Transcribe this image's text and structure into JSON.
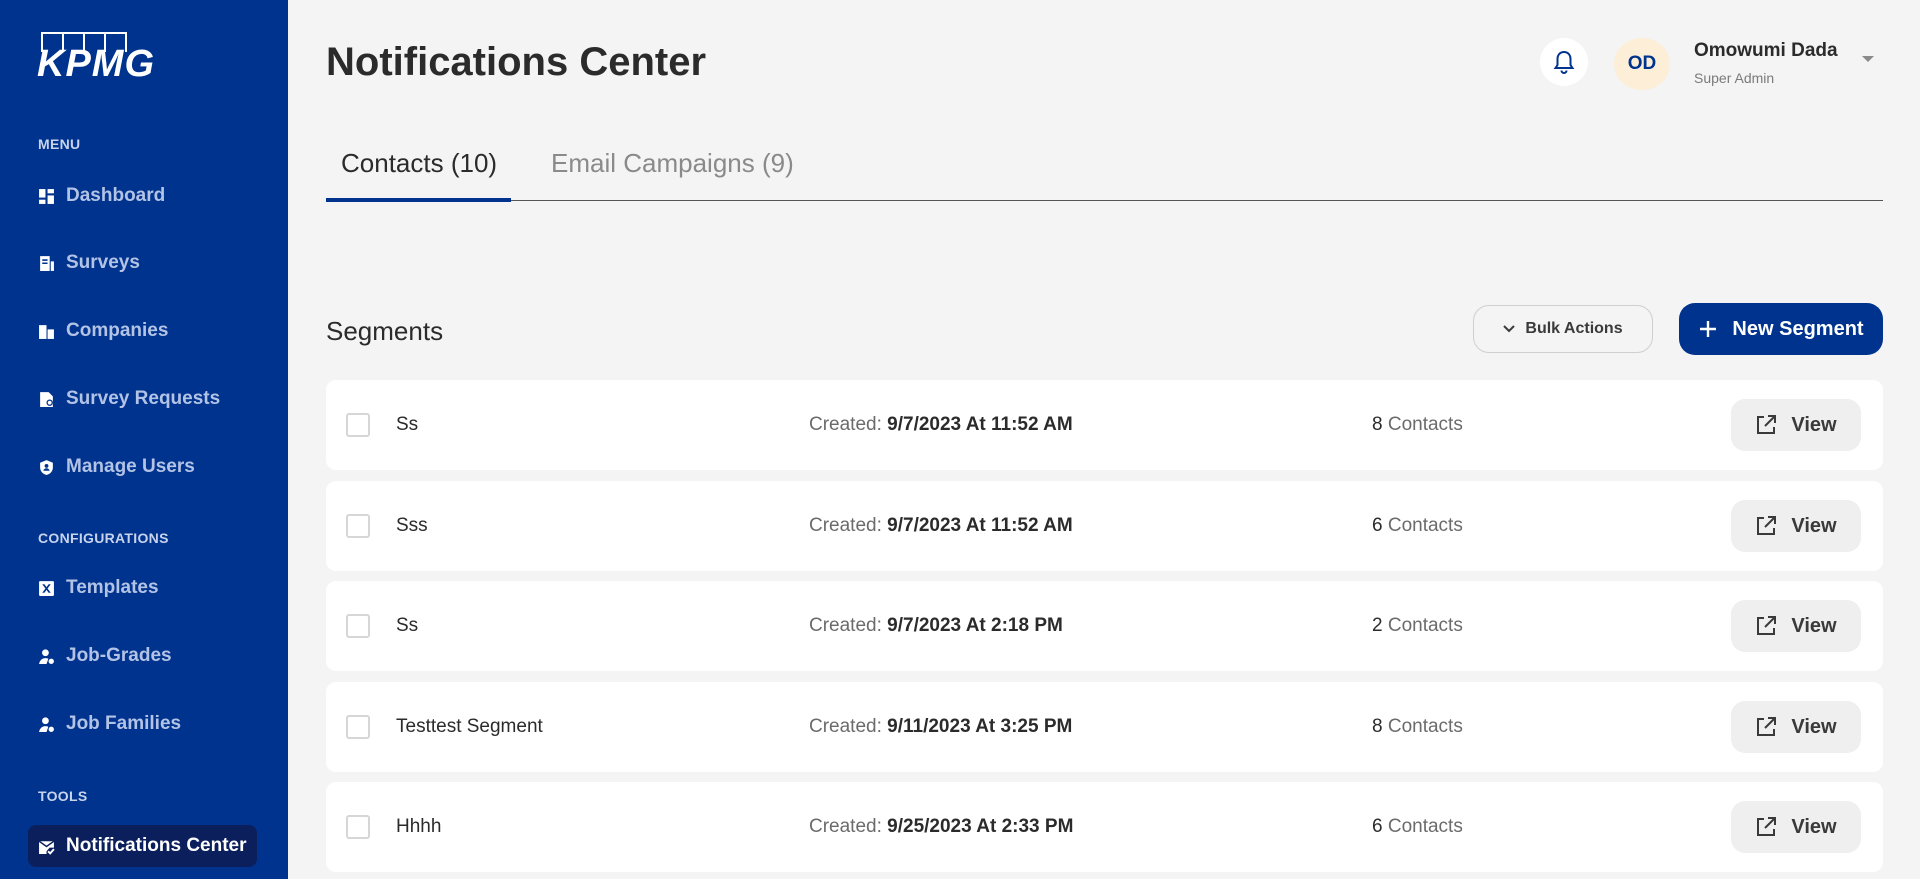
{
  "sidebar": {
    "logo": "KPMG",
    "menu_label": "MENU",
    "menu_items": [
      {
        "label": "Dashboard",
        "icon": "dashboard-icon"
      },
      {
        "label": "Surveys",
        "icon": "survey-icon"
      },
      {
        "label": "Companies",
        "icon": "building-icon"
      },
      {
        "label": "Survey Requests",
        "icon": "request-icon"
      },
      {
        "label": "Manage Users",
        "icon": "shield-user-icon"
      }
    ],
    "config_label": "CONFIGURATIONS",
    "config_items": [
      {
        "label": "Templates",
        "icon": "excel-icon"
      },
      {
        "label": "Job-Grades",
        "icon": "user-gear-icon"
      },
      {
        "label": "Job Families",
        "icon": "user-gear-icon"
      }
    ],
    "tools_label": "TOOLS",
    "tools_items": [
      {
        "label": "Notifications Center",
        "icon": "mail-check-icon",
        "active": true
      }
    ]
  },
  "header": {
    "title": "Notifications Center",
    "user": {
      "initials": "OD",
      "name": "Omowumi Dada",
      "role": "Super Admin"
    }
  },
  "tabs": [
    {
      "label": "Contacts (10)",
      "active": true
    },
    {
      "label": "Email Campaigns (9)",
      "active": false
    }
  ],
  "segments": {
    "title": "Segments",
    "bulk_label": "Bulk Actions",
    "new_label": "New Segment",
    "created_prefix": "Created:",
    "contacts_suffix": "Contacts",
    "view_label": "View",
    "rows": [
      {
        "name": "Ss",
        "created": "9/7/2023 At 11:52 AM",
        "count": "8"
      },
      {
        "name": "Sss",
        "created": "9/7/2023 At 11:52 AM",
        "count": "6"
      },
      {
        "name": "Ss",
        "created": "9/7/2023 At 2:18 PM",
        "count": "2"
      },
      {
        "name": "Testtest Segment",
        "created": "9/11/2023 At 3:25 PM",
        "count": "8"
      },
      {
        "name": "Hhhh",
        "created": "9/25/2023 At 2:33 PM",
        "count": "6"
      }
    ]
  },
  "colors": {
    "brand": "#00338d",
    "background": "#f4f4f4"
  }
}
